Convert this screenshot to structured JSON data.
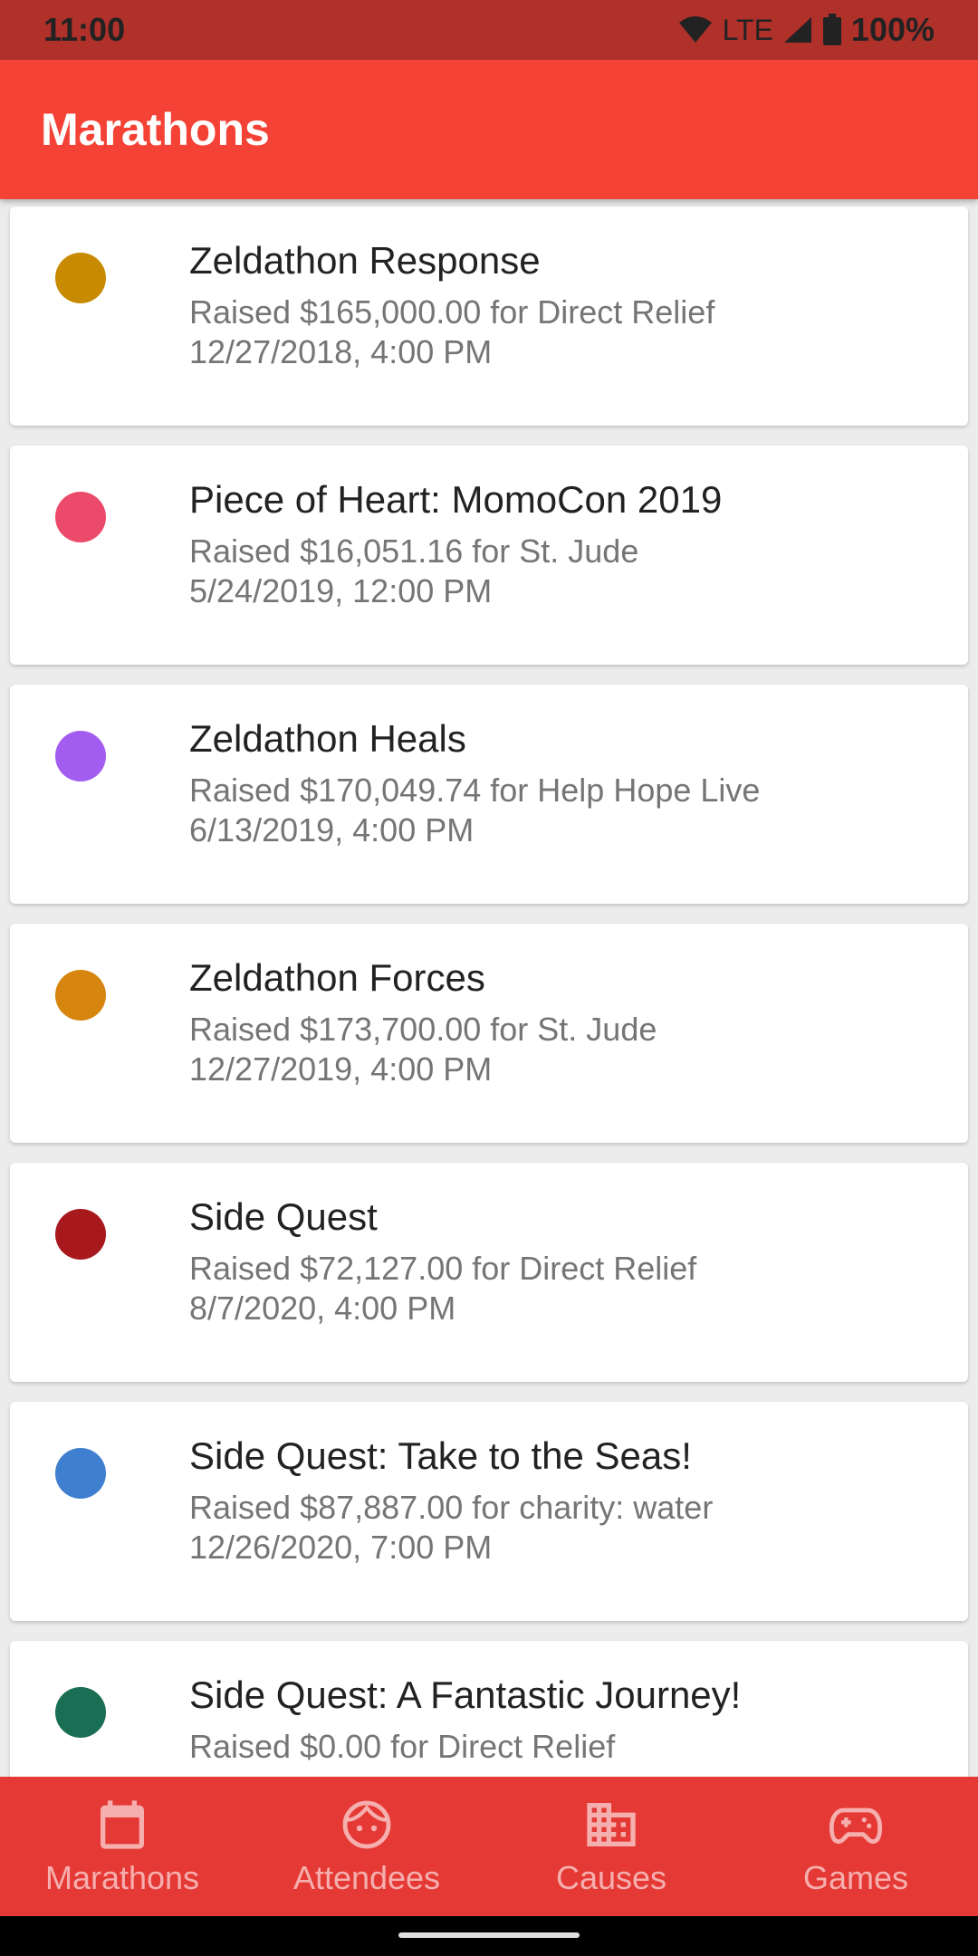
{
  "status_bar": {
    "time": "11:00",
    "network": "LTE",
    "battery": "100%"
  },
  "app_bar": {
    "title": "Marathons"
  },
  "marathons": [
    {
      "title": "Zeldathon Response",
      "raised": "Raised $165,000.00 for Direct Relief",
      "date": "12/27/2018, 4:00 PM",
      "color": "#c88a00"
    },
    {
      "title": "Piece of Heart: MomoCon 2019",
      "raised": "Raised $16,051.16 for St. Jude",
      "date": "5/24/2019, 12:00 PM",
      "color": "#ec4a6a"
    },
    {
      "title": "Zeldathon Heals",
      "raised": "Raised $170,049.74 for Help Hope Live",
      "date": "6/13/2019, 4:00 PM",
      "color": "#a25cf0"
    },
    {
      "title": "Zeldathon Forces",
      "raised": "Raised $173,700.00 for St. Jude",
      "date": "12/27/2019, 4:00 PM",
      "color": "#d6860e"
    },
    {
      "title": "Side Quest",
      "raised": "Raised $72,127.00 for Direct Relief",
      "date": "8/7/2020, 4:00 PM",
      "color": "#a8191e"
    },
    {
      "title": "Side Quest: Take to the Seas!",
      "raised": "Raised $87,887.00 for charity: water",
      "date": "12/26/2020, 7:00 PM",
      "color": "#3f7fcf"
    },
    {
      "title": "Side Quest: A Fantastic Journey!",
      "raised": "Raised $0.00 for Direct Relief",
      "date": "",
      "color": "#1a6e54"
    }
  ],
  "bottom_nav": [
    {
      "label": "Marathons",
      "icon": "calendar-icon",
      "active": true
    },
    {
      "label": "Attendees",
      "icon": "face-icon",
      "active": false
    },
    {
      "label": "Causes",
      "icon": "building-icon",
      "active": false
    },
    {
      "label": "Games",
      "icon": "gamepad-icon",
      "active": false
    }
  ]
}
